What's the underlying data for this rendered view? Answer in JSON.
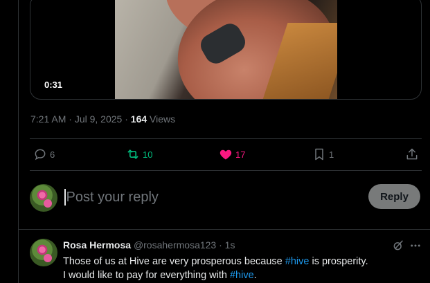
{
  "video": {
    "duration": "0:31"
  },
  "post_meta": {
    "time": "7:21 AM",
    "date": "Jul 9, 2025",
    "views_count": "164",
    "views_label": "Views",
    "separator": "·"
  },
  "actions": {
    "replies": "6",
    "reposts": "10",
    "likes": "17",
    "bookmarks": "1",
    "colors": {
      "repost_active": "#00ba7c",
      "like_active": "#f91880",
      "muted": "#71767b"
    }
  },
  "composer": {
    "placeholder": "Post your reply",
    "reply_button": "Reply"
  },
  "reply_tweet": {
    "name": "Rosa Hermosa",
    "handle": "@rosahermosa123",
    "separator": "·",
    "time": "1s",
    "line1_before": "Those of us at Hive are very prosperous because ",
    "line1_hashtag": "#hive",
    "line1_after": " is prosperity.",
    "line2_before": "I would like to pay for everything with ",
    "line2_hashtag": "#hive",
    "line2_after": "."
  },
  "icons": [
    "reply-icon",
    "repost-icon",
    "heart-icon",
    "bookmark-icon",
    "share-icon",
    "grok-icon",
    "more-icon"
  ],
  "theme": {
    "background": "#000000",
    "text": "#e7e9ea",
    "link": "#1d9bf0",
    "border": "#2f3336"
  }
}
